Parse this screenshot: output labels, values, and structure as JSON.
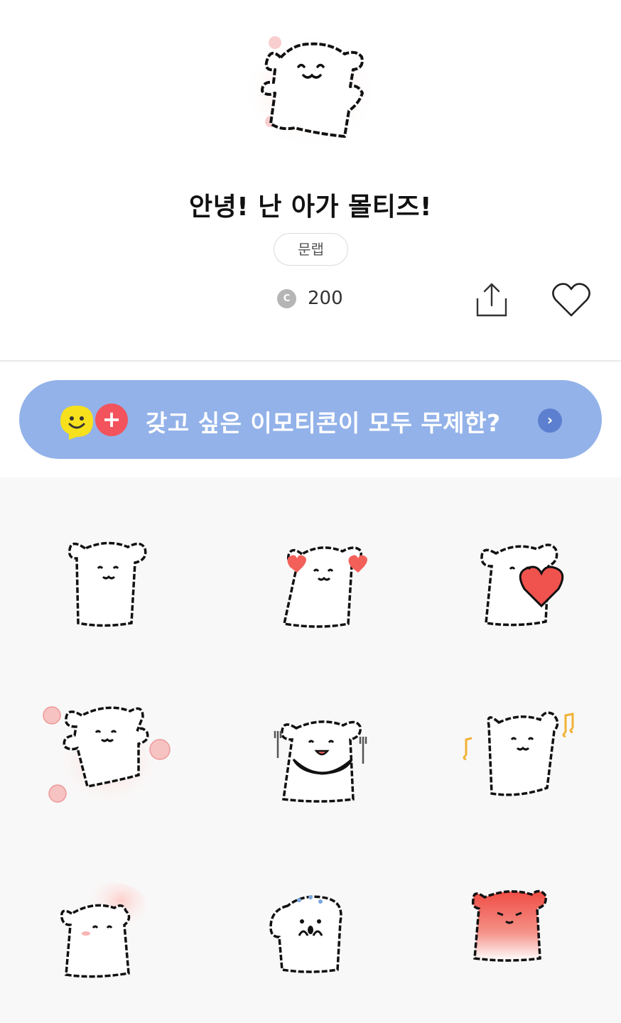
{
  "product": {
    "title": "안녕! 난 아가 몰티즈!",
    "author": "문랩",
    "price": "200",
    "coin_label": "C"
  },
  "actions": {
    "share_icon": "share-icon",
    "like_icon": "heart-outline-icon"
  },
  "promo": {
    "text": "갖고 싶은 이모티콘이 모두 무제한?",
    "plus_label": "+",
    "arrow_label": "›",
    "background": "#93b2e9",
    "plus_color": "#f2535c",
    "smile_color": "#f7e11c"
  },
  "stickers": [
    {
      "name": "arms-up-cheer"
    },
    {
      "name": "holding-two-hearts"
    },
    {
      "name": "hugging-big-heart"
    },
    {
      "name": "dancing-with-flowers"
    },
    {
      "name": "bib-with-forks"
    },
    {
      "name": "dancing-with-music-notes"
    },
    {
      "name": "blushing-sitting"
    },
    {
      "name": "sweating-surprised"
    },
    {
      "name": "red-angry-face"
    }
  ]
}
